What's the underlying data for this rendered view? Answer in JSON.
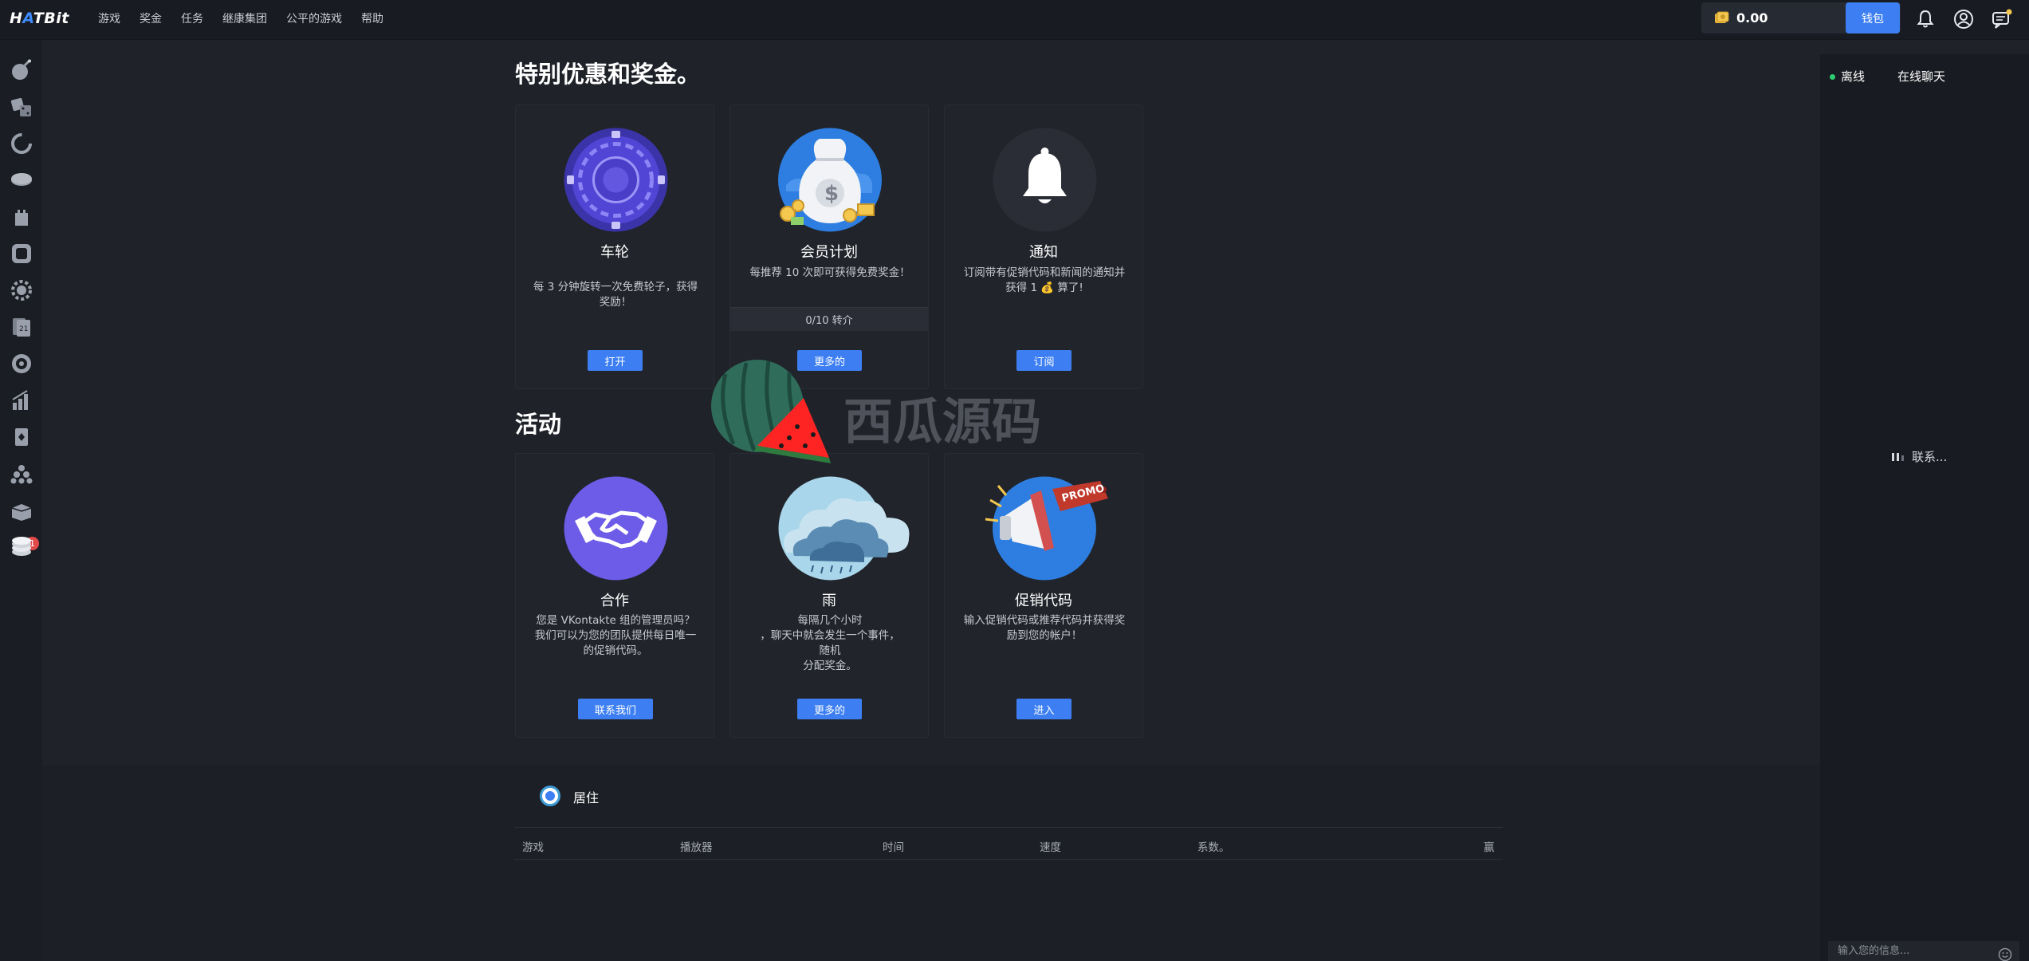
{
  "header": {
    "logo_part1": "H",
    "logo_accent": "A",
    "logo_part2": "TBit",
    "nav": [
      "游戏",
      "奖金",
      "任务",
      "继康集团",
      "公平的游戏",
      "帮助"
    ],
    "balance": "0.00",
    "wallet_label": "钱包"
  },
  "sidebar": {
    "icons": [
      "bomb-icon",
      "dice-icon",
      "crash-icon",
      "coin-stack-icon",
      "tower-icon",
      "slot-icon",
      "gear-wheel-icon",
      "cards-21-icon",
      "roulette-icon",
      "chart-up-icon",
      "card-suit-icon",
      "balls-icon",
      "box-icon",
      "coins-icon"
    ],
    "badge": "1"
  },
  "bonuses": {
    "title": "特别优惠和奖金。",
    "cards": [
      {
        "title": "车轮",
        "desc": "每 3 分钟旋转一次免费轮子，获得奖励！",
        "button": "打开",
        "icon": "wheel-icon"
      },
      {
        "title": "会员计划",
        "desc": "每推荐 10 次即可获得免费奖金！",
        "progress": "0/10 转介",
        "button": "更多的",
        "icon": "money-bag-icon"
      },
      {
        "title": "通知",
        "desc": "订阅带有促销代码和新闻的通知并获得 1 💰 算了!",
        "button": "订阅",
        "icon": "bell-icon"
      }
    ]
  },
  "activities": {
    "title": "活动",
    "cards": [
      {
        "title": "合作",
        "desc": "您是 VKontakte 组的管理员吗？我们可以为您的团队提供每日唯一的促销代码。",
        "button": "联系我们",
        "icon": "handshake-icon"
      },
      {
        "title": "雨",
        "desc_lines": [
          "每隔几个小时",
          "，聊天中就会发生一个事件，",
          "随机",
          "分配奖金。"
        ],
        "button": "更多的",
        "icon": "cloud-rain-icon"
      },
      {
        "title": "促销代码",
        "desc": "输入促销代码或推荐代码并获得奖励到您的帐户！",
        "button": "进入",
        "icon": "promo-megaphone-icon"
      }
    ]
  },
  "live": {
    "label": "居住",
    "columns": [
      "游戏",
      "播放器",
      "时间",
      "速度",
      "系数。",
      "赢"
    ]
  },
  "chat": {
    "offline_label": "离线",
    "tab_label": "在线聊天",
    "connecting": "联系...",
    "input_placeholder": "输入您的信息..."
  },
  "watermark": {
    "text": "西瓜源码"
  },
  "colors": {
    "accent": "#3d7ff2",
    "bg": "#1f2229",
    "card": "#21242b",
    "online": "#2ecc71"
  }
}
